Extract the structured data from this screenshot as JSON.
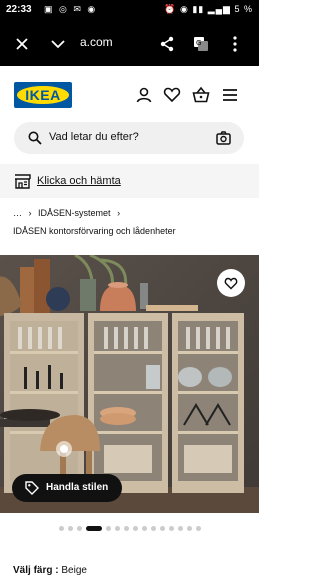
{
  "status_bar": {
    "time": "22:33",
    "battery": "5 %"
  },
  "browser": {
    "url": "a.com"
  },
  "header": {
    "logo_text": "IKEA"
  },
  "search": {
    "placeholder": "Vad letar du efter?"
  },
  "click_collect": {
    "label": "Klicka och hämta"
  },
  "breadcrumb": {
    "ellipsis": "…",
    "item": "IDÅSEN-systemet"
  },
  "page": {
    "subtitle": "IDÅSEN kontorsförvaring och lådenheter"
  },
  "hero": {
    "style_button_label": "Handla stilen",
    "carousel_dot_count": 15,
    "carousel_active_index": 3
  },
  "color_selector": {
    "label": "Välj färg :",
    "value": "Beige"
  }
}
